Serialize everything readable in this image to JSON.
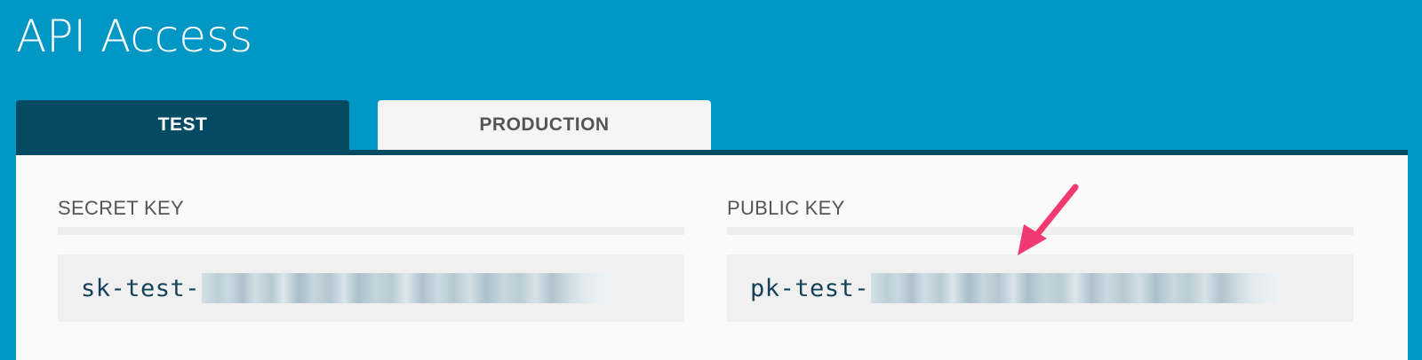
{
  "page": {
    "title": "API Access"
  },
  "tabs": [
    {
      "label": "TEST",
      "active": true
    },
    {
      "label": "PRODUCTION",
      "active": false
    }
  ],
  "keys": {
    "secret": {
      "label": "SECRET KEY",
      "prefix": "sk-test-"
    },
    "public": {
      "label": "PUBLIC KEY",
      "prefix": "pk-test-"
    }
  },
  "annotation": {
    "arrow_color": "#f23a72"
  },
  "colors": {
    "background": "#0097c4",
    "active_tab": "#044a62",
    "inactive_tab": "#f5f5f5",
    "panel": "#fafafa",
    "key_text": "#14425a"
  },
  "icons": {
    "arrow": "pointer-arrow-icon"
  }
}
